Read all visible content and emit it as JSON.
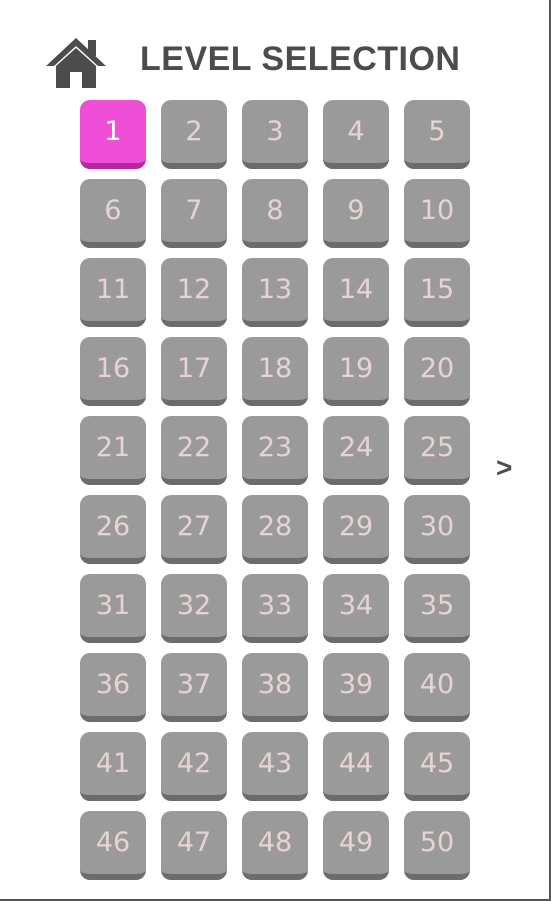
{
  "header": {
    "title": "LEVEL SELECTION",
    "home_icon": "home-icon"
  },
  "levels": {
    "items": [
      "1",
      "2",
      "3",
      "4",
      "5",
      "6",
      "7",
      "8",
      "9",
      "10",
      "11",
      "12",
      "13",
      "14",
      "15",
      "16",
      "17",
      "18",
      "19",
      "20",
      "21",
      "22",
      "23",
      "24",
      "25",
      "26",
      "27",
      "28",
      "29",
      "30",
      "31",
      "32",
      "33",
      "34",
      "35",
      "36",
      "37",
      "38",
      "39",
      "40",
      "41",
      "42",
      "43",
      "44",
      "45",
      "46",
      "47",
      "48",
      "49",
      "50"
    ],
    "selected": "1"
  },
  "navigation": {
    "next_label": ">"
  },
  "colors": {
    "selected_tile": "#ee4fd6",
    "locked_tile": "#9b9a9a",
    "title_text": "#4d4b4e"
  }
}
